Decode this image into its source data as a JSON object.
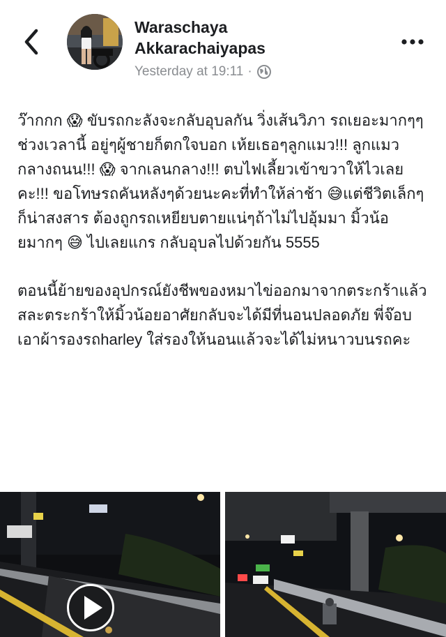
{
  "post": {
    "author_lines": [
      "Waraschaya",
      "Akkarachaiyapas"
    ],
    "timestamp": "Yesterday at 19:11",
    "separator": "·",
    "audience_icon": "globe-icon",
    "paragraph1": "ว๊ากกก 😱 ขับรถกะลังจะกลับอุบลกัน วิ่งเส้นวิภา รถเยอะมากๆๆช่วงเวลานี้ อยู่ๆผู้ชายก็ตกใจบอก เห้ยเธอๆลูกแมว!!! ลูกแมวกลางถนน!!! 😱 จากเลนกลาง!!! ตบไฟเลี้ยวเข้าขวาให้ไวเลยคะ!!! ขอโทษรถคันหลังๆด้วยนะคะที่ทำให้ล่าช้า 😅แต่ชีวิตเล็กๆก็น่าสงสาร ต้องถูกรถเหยียบตายแน่ๆถ้าไม่ไปอุ้มมา มิ้วน้อยมากๆ 😅 ไปเลยแกร กลับอุบลไปด้วยกัน 5555",
    "paragraph2": "ตอนนี้ย้ายของอุปกรณ์ยังชีพของหมาไข่ออกมาจากตระกร้าแล้ว สละตระกร้าให้มิ้วน้อยอาศัยกลับจะได้มีที่นอนปลอดภัย พี่จ๊อบเอาผ้ารองรถharley ใส่รองให้นอนแล้วจะได้ไม่หนาวบนรถคะ"
  },
  "icons": {
    "back": "chevron-left-icon",
    "more": "more-dots-icon",
    "play": "play-icon"
  },
  "colors": {
    "text": "#1c1e21",
    "meta": "#8a8d91",
    "background": "#ffffff"
  }
}
